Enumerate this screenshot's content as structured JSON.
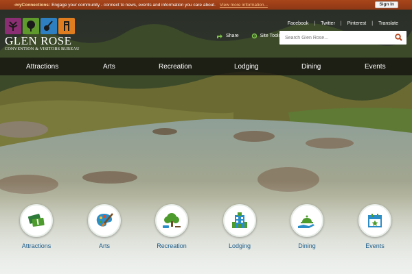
{
  "banner": {
    "brand": "-myConnections:",
    "message": "Engage your community - connect to news, events and information you care about.",
    "more_link": "View more information...",
    "sign_in": "Sign In"
  },
  "logo": {
    "title": "GLEN ROSE",
    "subtitle": "CONVENTION & VISITORS BUREAU",
    "tile_colors": [
      "#8c2e73",
      "#5f9a2d",
      "#2d7fc1",
      "#e07d1f"
    ]
  },
  "social_links": [
    "Facebook",
    "Twitter",
    "Pinterest",
    "Translate"
  ],
  "tools": {
    "share": "Share",
    "site_tools": "Site Tools"
  },
  "search": {
    "placeholder": "Search Glen Rose..."
  },
  "nav": [
    "Attractions",
    "Arts",
    "Recreation",
    "Lodging",
    "Dining",
    "Events"
  ],
  "categories": [
    {
      "label": "Attractions",
      "icon": "tickets-icon"
    },
    {
      "label": "Arts",
      "icon": "palette-icon"
    },
    {
      "label": "Recreation",
      "icon": "tree-icon"
    },
    {
      "label": "Lodging",
      "icon": "hotel-icon"
    },
    {
      "label": "Dining",
      "icon": "cloche-icon"
    },
    {
      "label": "Events",
      "icon": "calendar-icon"
    }
  ],
  "colors": {
    "banner": "#9a3f17",
    "accent_green": "#4e9b2d",
    "label_blue": "#1a5b8a"
  }
}
